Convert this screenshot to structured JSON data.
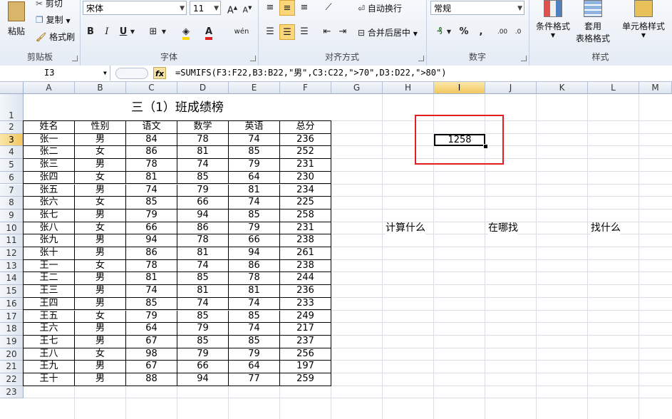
{
  "ribbon": {
    "clipboard": {
      "label": "剪贴板",
      "paste": "粘贴",
      "cut": "剪切",
      "copy": "复制",
      "format_painter": "格式刷"
    },
    "font": {
      "label": "字体",
      "font_name": "宋体",
      "font_size": "11",
      "bold": "B",
      "italic": "I",
      "underline": "U",
      "phonetic": "wén"
    },
    "alignment": {
      "label": "对齐方式",
      "wrap_text": "自动换行",
      "merge_center": "合并后居中"
    },
    "number": {
      "label": "数字",
      "format": "常规",
      "percent": "%",
      "comma": ","
    },
    "styles": {
      "label": "样式",
      "conditional": "条件格式",
      "table_format_1": "套用",
      "table_format_2": "表格格式",
      "cell_styles": "单元格样式"
    }
  },
  "formula_bar": {
    "name_box": "I3",
    "fx": "fx",
    "formula": "=SUMIFS(F3:F22,B3:B22,\"男\",C3:C22,\">70\",D3:D22,\">80\")"
  },
  "sheet": {
    "columns": [
      "A",
      "B",
      "C",
      "D",
      "E",
      "F",
      "G",
      "H",
      "I",
      "J",
      "K",
      "L",
      "M"
    ],
    "selected_column": "I",
    "rows": [
      "1",
      "2",
      "3",
      "4",
      "5",
      "6",
      "7",
      "8",
      "9",
      "10",
      "11",
      "12",
      "13",
      "14",
      "15",
      "16",
      "17",
      "18",
      "19",
      "20",
      "21",
      "22",
      "23"
    ],
    "selected_row": "3",
    "table_title": "三（1）班成绩榜",
    "headers": [
      "姓名",
      "性别",
      "语文",
      "数学",
      "英语",
      "总分"
    ],
    "records": [
      [
        "张一",
        "男",
        "84",
        "78",
        "74",
        "236"
      ],
      [
        "张二",
        "女",
        "86",
        "81",
        "85",
        "252"
      ],
      [
        "张三",
        "男",
        "78",
        "74",
        "79",
        "231"
      ],
      [
        "张四",
        "女",
        "81",
        "85",
        "64",
        "230"
      ],
      [
        "张五",
        "男",
        "74",
        "79",
        "81",
        "234"
      ],
      [
        "张六",
        "女",
        "85",
        "66",
        "74",
        "225"
      ],
      [
        "张七",
        "男",
        "79",
        "94",
        "85",
        "258"
      ],
      [
        "张八",
        "女",
        "66",
        "86",
        "79",
        "231"
      ],
      [
        "张九",
        "男",
        "94",
        "78",
        "66",
        "238"
      ],
      [
        "张十",
        "男",
        "86",
        "81",
        "94",
        "261"
      ],
      [
        "王一",
        "女",
        "78",
        "74",
        "86",
        "238"
      ],
      [
        "王二",
        "男",
        "81",
        "85",
        "78",
        "244"
      ],
      [
        "王三",
        "男",
        "74",
        "81",
        "81",
        "236"
      ],
      [
        "王四",
        "男",
        "85",
        "74",
        "74",
        "233"
      ],
      [
        "王五",
        "女",
        "79",
        "85",
        "85",
        "249"
      ],
      [
        "王六",
        "男",
        "64",
        "79",
        "74",
        "217"
      ],
      [
        "王七",
        "男",
        "67",
        "85",
        "85",
        "237"
      ],
      [
        "王八",
        "女",
        "98",
        "79",
        "79",
        "256"
      ],
      [
        "王九",
        "男",
        "67",
        "66",
        "64",
        "197"
      ],
      [
        "王十",
        "男",
        "88",
        "94",
        "77",
        "259"
      ]
    ],
    "result_value": "1258",
    "annotations": {
      "h10": "计算什么",
      "j10": "在哪找",
      "l10": "找什么"
    },
    "highlight_color": "#e02020"
  }
}
